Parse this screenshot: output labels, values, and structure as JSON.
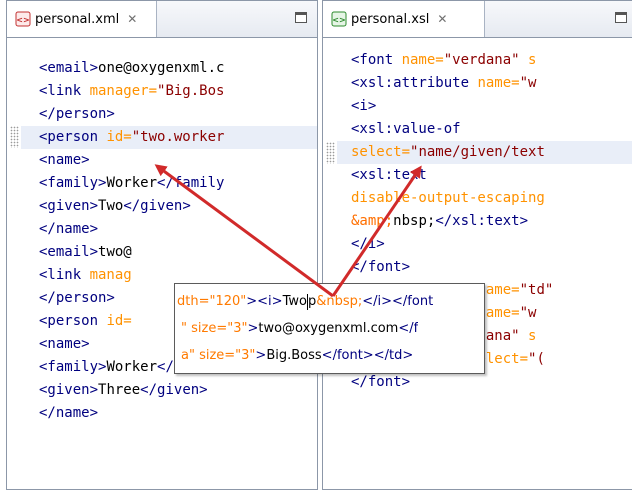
{
  "left_editor": {
    "tab": {
      "icon": "xml-file-icon",
      "label": "personal.xml",
      "close": "✕"
    },
    "lines": [
      [
        {
          "k": "t",
          "s": "<email>"
        },
        {
          "k": "x",
          "s": "one@oxygenxml.c"
        }
      ],
      [
        {
          "k": "t",
          "s": "<link "
        },
        {
          "k": "a",
          "s": "manager="
        },
        {
          "k": "v",
          "s": "\"Big.Bos"
        }
      ],
      [
        {
          "k": "t",
          "s": "</person>"
        }
      ],
      [
        {
          "k": "t",
          "s": "<person "
        },
        {
          "k": "a",
          "s": "id="
        },
        {
          "k": "v",
          "s": "\"two.worker"
        }
      ],
      [
        {
          "k": "t",
          "s": "<name>"
        }
      ],
      [
        {
          "k": "t",
          "s": "<family>"
        },
        {
          "k": "x",
          "s": "Worker"
        },
        {
          "k": "t",
          "s": "</family"
        }
      ],
      [
        {
          "k": "t",
          "s": "<given>"
        },
        {
          "k": "x",
          "s": "Two"
        },
        {
          "k": "t",
          "s": "</given>"
        }
      ],
      [
        {
          "k": "t",
          "s": "</name>"
        }
      ],
      [
        {
          "k": "t",
          "s": "<email>"
        },
        {
          "k": "x",
          "s": "two@"
        }
      ],
      [
        {
          "k": "t",
          "s": "<link "
        },
        {
          "k": "a",
          "s": "manag"
        }
      ],
      [
        {
          "k": "t",
          "s": "</person>"
        }
      ],
      [
        {
          "k": "t",
          "s": "<person "
        },
        {
          "k": "a",
          "s": "id="
        }
      ],
      [
        {
          "k": "t",
          "s": "<name>"
        }
      ],
      [
        {
          "k": "t",
          "s": "<family>"
        },
        {
          "k": "x",
          "s": "Worker"
        },
        {
          "k": "t",
          "s": "</family"
        }
      ],
      [
        {
          "k": "t",
          "s": "<given>"
        },
        {
          "k": "x",
          "s": "Three"
        },
        {
          "k": "t",
          "s": "</given>"
        }
      ],
      [
        {
          "k": "t",
          "s": "</name>"
        }
      ]
    ],
    "highlight_line": 3
  },
  "right_editor": {
    "tab": {
      "icon": "xsl-file-icon",
      "label": "personal.xsl",
      "close": "✕"
    },
    "lines": [
      [
        {
          "k": "t",
          "s": "<font "
        },
        {
          "k": "a",
          "s": "name="
        },
        {
          "k": "v",
          "s": "\"verdana\" "
        },
        {
          "k": "a",
          "s": "s"
        }
      ],
      [
        {
          "k": "t",
          "s": "<xsl:attribute "
        },
        {
          "k": "a",
          "s": "name="
        },
        {
          "k": "v",
          "s": "\"w"
        }
      ],
      [
        {
          "k": "t",
          "s": "<i>"
        }
      ],
      [
        {
          "k": "t",
          "s": "<xsl:value-of"
        }
      ],
      [
        {
          "k": "a",
          "s": "select="
        },
        {
          "k": "v",
          "s": "\"name/given/text"
        }
      ],
      [
        {
          "k": "t",
          "s": "<xsl:text"
        }
      ],
      [
        {
          "k": "a",
          "s": "disable-output-escaping"
        }
      ],
      [
        {
          "k": "c",
          "s": "&amp;"
        },
        {
          "k": "x",
          "s": "nbsp;"
        },
        {
          "k": "t",
          "s": "</xsl:text>"
        }
      ],
      [
        {
          "k": "t",
          "s": "</i>"
        }
      ],
      [
        {
          "k": "t",
          "s": "</font>"
        }
      ],
      [
        {
          "k": "t",
          "s": "<xsl:attribute "
        },
        {
          "k": "a",
          "s": "name="
        },
        {
          "k": "v",
          "s": "\"td\""
        }
      ],
      [
        {
          "k": "t",
          "s": "<xsl:attribute "
        },
        {
          "k": "a",
          "s": "name="
        },
        {
          "k": "v",
          "s": "\"w"
        }
      ],
      [
        {
          "k": "t",
          "s": "<font "
        },
        {
          "k": "a",
          "s": "name="
        },
        {
          "k": "v",
          "s": "\"verdana\" "
        },
        {
          "k": "a",
          "s": "s"
        }
      ],
      [
        {
          "k": "t",
          "s": "<xsl:value-of "
        },
        {
          "k": "a",
          "s": "select="
        },
        {
          "k": "v",
          "s": "\"("
        }
      ],
      [
        {
          "k": "t",
          "s": "</font>"
        }
      ]
    ],
    "highlight_line": 4
  },
  "popup": {
    "rows": [
      [
        {
          "k": "p-attr",
          "s": "dth=\"120\""
        },
        {
          "k": "p-tag",
          "s": "><i>"
        },
        {
          "k": "p-txt",
          "s": "Two"
        },
        {
          "k": "caret",
          "s": ""
        },
        {
          "k": "p-txt",
          "s": "p"
        },
        {
          "k": "p-attr",
          "s": "&nbsp;"
        },
        {
          "k": "p-tag",
          "s": "</i></font"
        }
      ],
      [
        {
          "k": "p-attr",
          "s": "\" size=\"3\""
        },
        {
          "k": "p-tag",
          "s": ">"
        },
        {
          "k": "p-txt",
          "s": "two@oxygenxml.com"
        },
        {
          "k": "p-tag",
          "s": "</f"
        }
      ],
      [
        {
          "k": "p-attr",
          "s": "a\" size=\"3\""
        },
        {
          "k": "p-tag",
          "s": ">"
        },
        {
          "k": "p-txt",
          "s": "Big.Boss"
        },
        {
          "k": "p-tag",
          "s": "</font></td>"
        }
      ]
    ]
  },
  "colors": {
    "arrow": "#d12a2a",
    "highlight": "#e9eef8",
    "tag": "#00007f",
    "attribute": "#ff9200",
    "value": "#8b0000"
  }
}
